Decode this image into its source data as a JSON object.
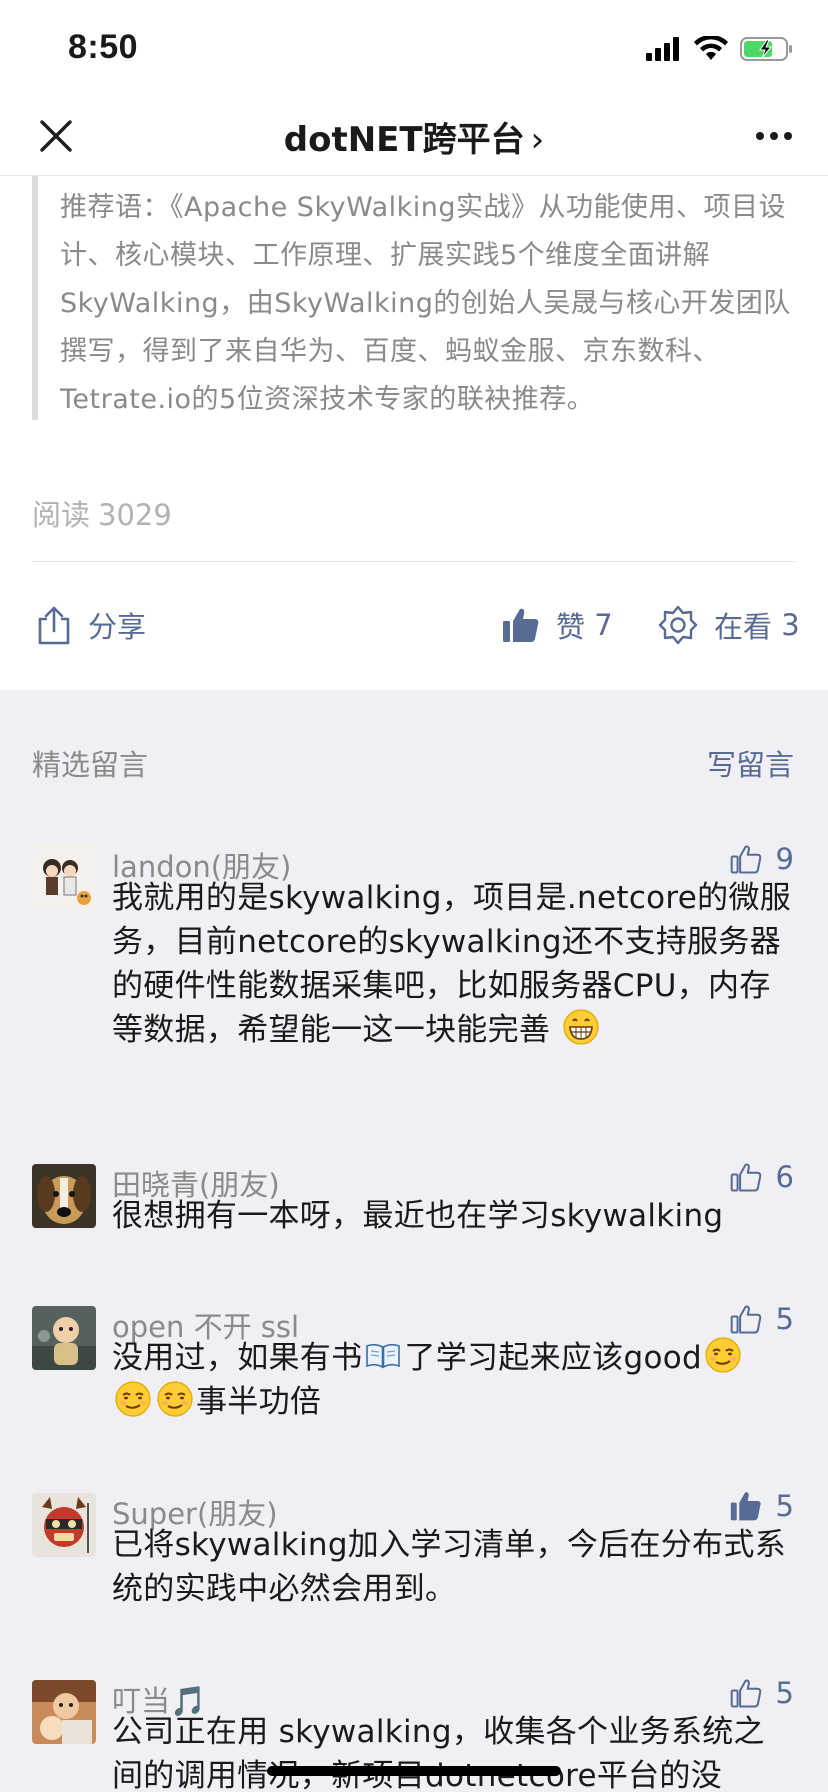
{
  "status_bar": {
    "time": "8:50"
  },
  "nav": {
    "title": "dotNET跨平台",
    "title_chevron": "›"
  },
  "article": {
    "quote": "推荐语：《Apache SkyWalking实战》从功能使用、项目设计、核心模块、工作原理、扩展实践5个维度全面讲解SkyWalking，由SkyWalking的创始人吴晟与核心开发团队撰写，得到了来自华为、百度、蚂蚁金服、京东数科、Tetrate.io的5位资深技术专家的联袂推荐。",
    "read_label": "阅读",
    "read_count": "3029"
  },
  "actions": {
    "share_label": "分享",
    "like_label": "赞",
    "like_count": "7",
    "looking_label": "在看",
    "looking_count": "3"
  },
  "comments": {
    "header_label": "精选留言",
    "write_label": "写留言",
    "items": [
      {
        "name": "landon(朋友)",
        "likes": "9",
        "text": "我就用的是skywalking，项目是.netcore的微服务，目前netcore的skywalking还不支持服务器的硬件性能数据采集吧，比如服务器CPU，内存等数据，希望能一这一块能完善",
        "liked": false
      },
      {
        "name": "田晓青(朋友)",
        "likes": "6",
        "text": "很想拥有一本呀，最近也在学习skywalking",
        "liked": false
      },
      {
        "name": "open 不开 ssl",
        "likes": "5",
        "text_part1": "没用过，如果有书",
        "text_part2": "了学习起来应该good",
        "text_part3": "事半功倍",
        "liked": false
      },
      {
        "name": "Super(朋友)",
        "likes": "5",
        "text": "已将skywalking加入学习清单，今后在分布式系统的实践中必然会用到。",
        "liked": true
      },
      {
        "name": "叮当🎵",
        "likes": "5",
        "text": "公司正在用 skywalking，收集各个业务系统之间的调用情况，新项目dotnetcore平台的没",
        "liked": false
      }
    ]
  },
  "colors": {
    "link_blue": "#576b95",
    "section_bg": "#efeff4",
    "battery_green": "#4cd964"
  }
}
